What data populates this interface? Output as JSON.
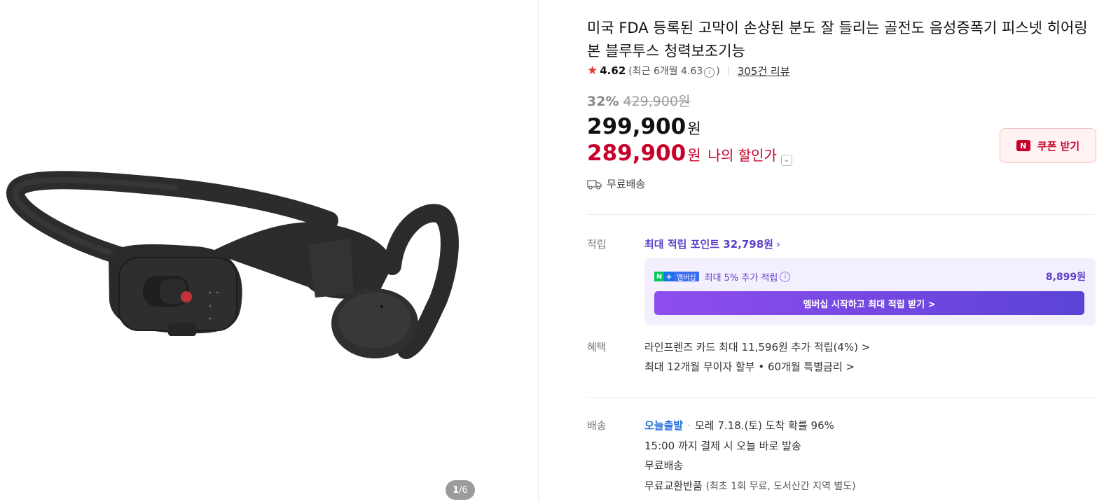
{
  "gallery": {
    "current_page": "1",
    "page_separator": "/",
    "total_pages": "6"
  },
  "product": {
    "title": "미국 FDA 등록된 고막이 손상된 분도 잘 들리는 골전도 음성증폭기 피스넷 히어링본 블루투스 청력보조기능"
  },
  "rating": {
    "score": "4.62",
    "recent_text": "(최근 6개월 4.63",
    "recent_close": ")",
    "reviews": "305건 리뷰"
  },
  "pricing": {
    "discount_rate": "32%",
    "original_price": "429,900원",
    "price": "299,900",
    "won": "원",
    "my_price": "289,900",
    "my_price_won": "원",
    "my_price_label": "나의 할인가"
  },
  "coupon": {
    "badge": "N",
    "label": "쿠폰 받기"
  },
  "shipping_summary": "무료배송",
  "points": {
    "section_label": "적립",
    "max_points": "최대 적립 포인트 32,798원",
    "membership_badge": "멤버십",
    "membership_text": "최대 5% 추가 적립",
    "membership_amount": "8,899원",
    "membership_button": "멤버십 시작하고 최대 적립 받기 >"
  },
  "benefits": {
    "section_label": "혜택",
    "card_text": "라인프렌즈 카드 최대 11,596원 추가 적립(4%) >",
    "installment_text": "최대 12개월 무이자 할부 • 60개월 특별금리 >"
  },
  "delivery": {
    "section_label": "배송",
    "today_label": "오늘출발",
    "arrival_text": "모레 7.18.(토) 도착 확률 96%",
    "cutoff_text": "15:00 까지 결제 시 오늘 바로 발송",
    "fee_text": "무료배송",
    "return_text": "무료교환반품",
    "return_detail": "(최초 1회 무료, 도서산간 지역 별도)"
  },
  "colors": {
    "sale_red": "#c7002b",
    "point_purple": "#5a3ec8",
    "today_blue": "#1f6ad8",
    "star_red": "#e5362a"
  }
}
